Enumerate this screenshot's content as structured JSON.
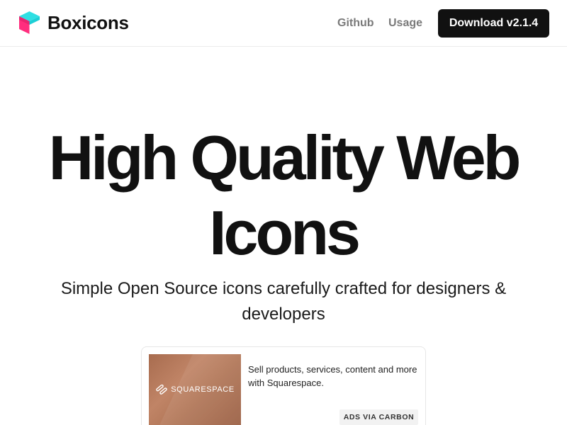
{
  "nav": {
    "brand": "Boxicons",
    "links": {
      "github": "Github",
      "usage": "Usage"
    },
    "download_label": "Download v2.1.4"
  },
  "hero": {
    "title_line1": "High Quality Web",
    "title_line2": "Icons",
    "subtitle": "Simple Open Source icons carefully crafted for designers & developers"
  },
  "ad": {
    "sponsor_logo_text": "SQUARESPACE",
    "text": "Sell products, services, content and more with Squarespace.",
    "via_label": "ADS VIA CARBON"
  },
  "colors": {
    "logo_cyan": "#2fdfe3",
    "logo_pink": "#ff2e7e",
    "button_bg": "#111111",
    "nav_link": "#7a7a7a"
  },
  "icons": {
    "brand": "boxicons-cube-logo",
    "sponsor": "squarespace-logo"
  }
}
